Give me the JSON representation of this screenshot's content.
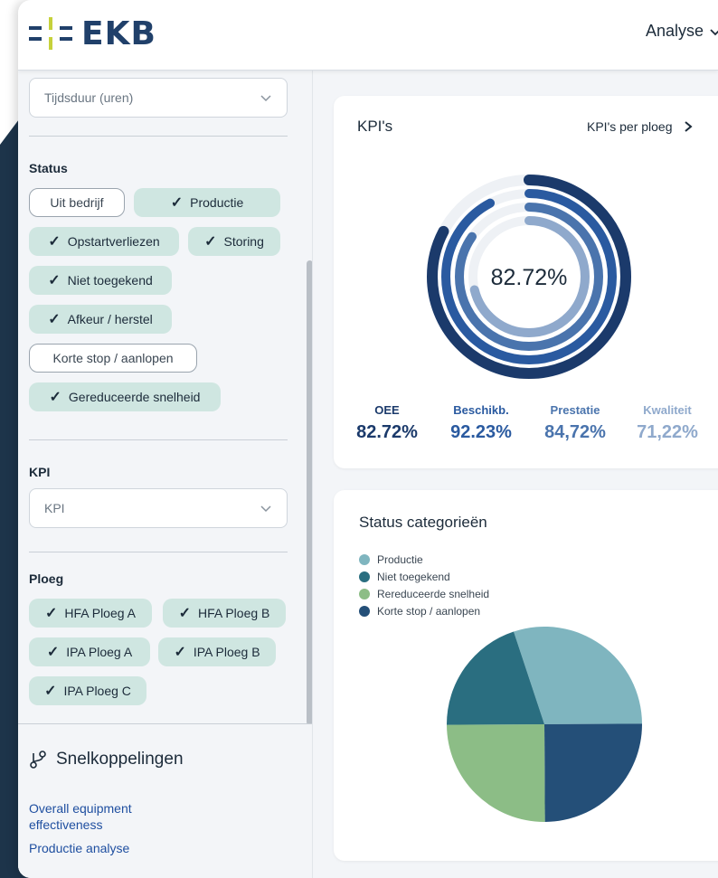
{
  "header": {
    "logo_text": "EKB",
    "nav_label": "Analyse",
    "nav_icon": "chevron-down-icon"
  },
  "sidebar": {
    "duration_select": {
      "placeholder": "Tijdsduur (uren)"
    },
    "status": {
      "title": "Status",
      "chips": [
        {
          "label": "Uit bedrijf",
          "checked": false
        },
        {
          "label": "Productie",
          "checked": true
        },
        {
          "label": "Opstartverliezen",
          "checked": true
        },
        {
          "label": "Storing",
          "checked": true
        },
        {
          "label": "Niet toegekend",
          "checked": true
        },
        {
          "label": "Afkeur / herstel",
          "checked": true
        },
        {
          "label": "Korte stop / aanlopen",
          "checked": false
        },
        {
          "label": "Gereduceerde snelheid",
          "checked": true
        }
      ]
    },
    "kpi": {
      "title": "KPI",
      "select_placeholder": "KPI"
    },
    "ploeg": {
      "title": "Ploeg",
      "chips": [
        {
          "label": "HFA Ploeg A",
          "checked": true
        },
        {
          "label": "HFA Ploeg B",
          "checked": true
        },
        {
          "label": "IPA Ploeg A",
          "checked": true
        },
        {
          "label": "IPA Ploeg B",
          "checked": true
        },
        {
          "label": "IPA Ploeg C",
          "checked": true
        }
      ]
    },
    "quicklinks": {
      "title": "Snelkoppelingen",
      "icon": "branch-link-icon",
      "links": [
        "Overall equipment effectiveness",
        "Productie analyse"
      ]
    }
  },
  "kpi_card": {
    "title": "KPI's",
    "link_label": "KPI's per ploeg",
    "center_value": "82.72%",
    "metrics": [
      {
        "label": "OEE",
        "value": "82.72%",
        "color": "#1b3a6b",
        "fraction": 0.8272
      },
      {
        "label": "Beschikb.",
        "value": "92.23%",
        "color": "#2a5aa0",
        "fraction": 0.9223
      },
      {
        "label": "Prestatie",
        "value": "84,72%",
        "color": "#4a74ad",
        "fraction": 0.8472
      },
      {
        "label": "Kwaliteit",
        "value": "71,22%",
        "color": "#8fa9cc",
        "fraction": 0.7122
      }
    ]
  },
  "status_card": {
    "title": "Status categorieën",
    "legend": [
      {
        "label": "Productie",
        "color": "#7fb5bf"
      },
      {
        "label": "Niet toegekend",
        "color": "#2a6e80"
      },
      {
        "label": "Rereduceerde snelheid",
        "color": "#8cbd86"
      },
      {
        "label": "Korte stop / aanlopen",
        "color": "#244f78"
      }
    ]
  },
  "chart_data": {
    "type": "pie",
    "categories": [
      "Productie",
      "Korte stop / aanlopen",
      "Rereduceerde snelheid",
      "Niet toegekend"
    ],
    "values": [
      30,
      25,
      25,
      20
    ],
    "colors": [
      "#7fb5bf",
      "#244f78",
      "#8cbd86",
      "#2a6e80"
    ]
  }
}
